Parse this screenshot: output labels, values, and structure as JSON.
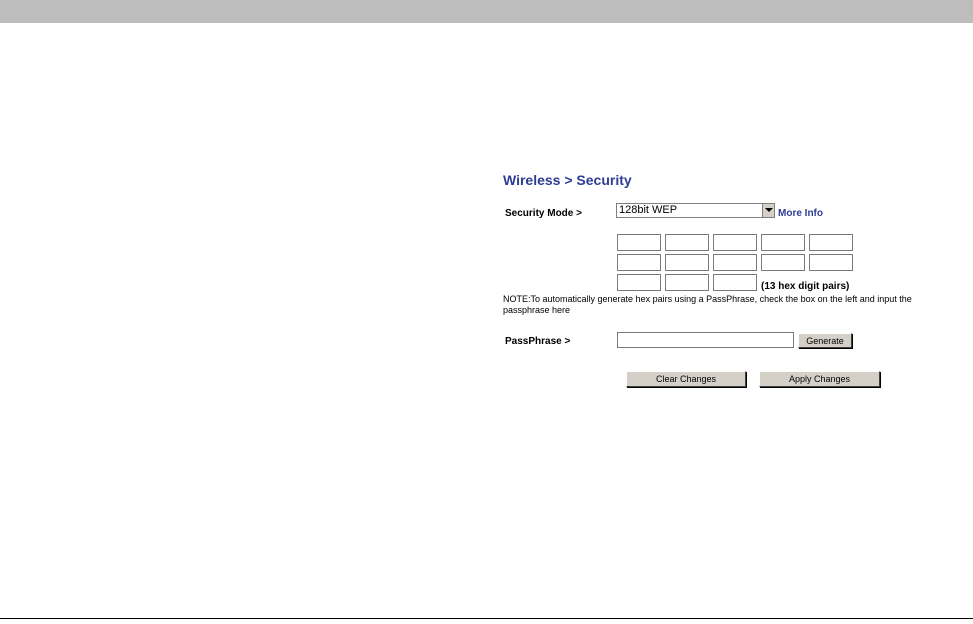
{
  "page": {
    "title": "Wireless > Security"
  },
  "security_mode": {
    "label": "Security Mode >",
    "selected": "128bit WEP",
    "more_info_label": "More Info"
  },
  "hex_key": {
    "fields": [
      "",
      "",
      "",
      "",
      "",
      "",
      "",
      "",
      "",
      "",
      "",
      "",
      ""
    ],
    "hint": "(13 hex digit pairs)"
  },
  "note": {
    "text": "NOTE:To automatically generate hex pairs using a PassPhrase, check the box on the left and input the passphrase here"
  },
  "passphrase": {
    "label": "PassPhrase >",
    "value": "",
    "generate_label": "Generate"
  },
  "actions": {
    "clear_label": "Clear Changes",
    "apply_label": "Apply Changes"
  },
  "colors": {
    "title_blue": "#2e3d94",
    "top_bar": "#bdbdbd",
    "button_face": "#d4d0c8"
  }
}
